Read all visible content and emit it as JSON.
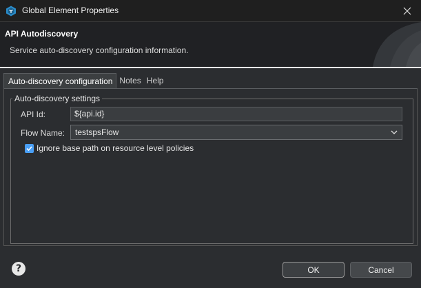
{
  "window": {
    "title": "Global Element Properties"
  },
  "banner": {
    "title": "API Autodiscovery",
    "description": "Service auto-discovery configuration information."
  },
  "tabs": [
    {
      "label": "Auto-discovery configuration",
      "active": true
    },
    {
      "label": "Notes",
      "active": false
    },
    {
      "label": "Help",
      "active": false
    }
  ],
  "settings": {
    "group_label": "Auto-discovery settings",
    "api_id_label": "API Id:",
    "api_id_value": "${api.id}",
    "flow_name_label": "Flow Name:",
    "flow_name_value": "testspsFlow",
    "ignore_base_path_label": "Ignore base path on resource level policies",
    "ignore_base_path_checked": true
  },
  "footer": {
    "ok_label": "OK",
    "cancel_label": "Cancel"
  },
  "colors": {
    "accent": "#4a9ff5",
    "window_bg": "#2b2d30"
  }
}
